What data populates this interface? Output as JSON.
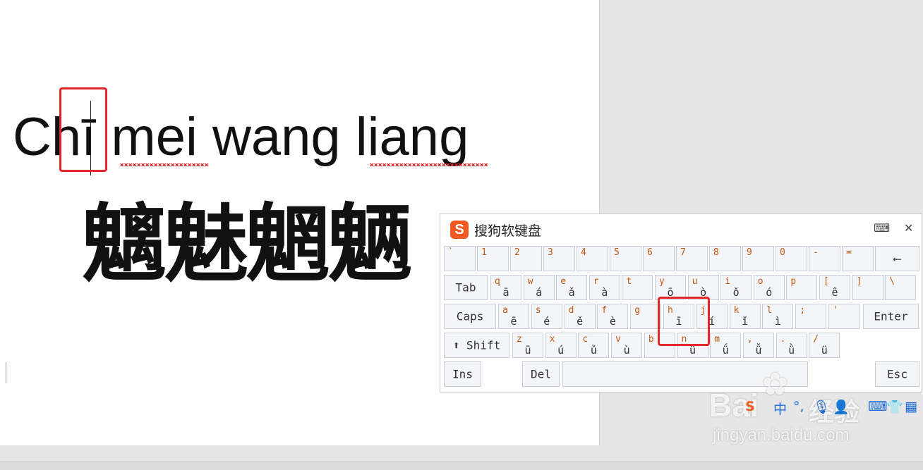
{
  "document": {
    "latin_line": "Chī mei wang liang",
    "cjk_line": "魑魅魍魉"
  },
  "keyboard": {
    "title": "搜狗软键盘",
    "logo": "S",
    "row1": [
      {
        "sym": "`",
        "big": ""
      },
      {
        "sym": "1",
        "big": ""
      },
      {
        "sym": "2",
        "big": ""
      },
      {
        "sym": "3",
        "big": ""
      },
      {
        "sym": "4",
        "big": ""
      },
      {
        "sym": "5",
        "big": ""
      },
      {
        "sym": "6",
        "big": ""
      },
      {
        "sym": "7",
        "big": ""
      },
      {
        "sym": "8",
        "big": ""
      },
      {
        "sym": "9",
        "big": ""
      },
      {
        "sym": "0",
        "big": ""
      },
      {
        "sym": "-",
        "big": ""
      },
      {
        "sym": "=",
        "big": ""
      }
    ],
    "backspace": "⟵",
    "tab": "Tab",
    "row2": [
      {
        "sym": "q",
        "big": "ā"
      },
      {
        "sym": "w",
        "big": "á"
      },
      {
        "sym": "e",
        "big": "ǎ"
      },
      {
        "sym": "r",
        "big": "à"
      },
      {
        "sym": "t",
        "big": ""
      },
      {
        "sym": "y",
        "big": "ō"
      },
      {
        "sym": "u",
        "big": "ò"
      },
      {
        "sym": "i",
        "big": "ǒ"
      },
      {
        "sym": "o",
        "big": "ó"
      },
      {
        "sym": "p",
        "big": ""
      },
      {
        "sym": "[",
        "big": "ê"
      },
      {
        "sym": "]",
        "big": ""
      },
      {
        "sym": "\\",
        "big": ""
      }
    ],
    "caps": "Caps",
    "row3": [
      {
        "sym": "a",
        "big": "ē"
      },
      {
        "sym": "s",
        "big": "é"
      },
      {
        "sym": "d",
        "big": "ě"
      },
      {
        "sym": "f",
        "big": "è"
      },
      {
        "sym": "g",
        "big": ""
      },
      {
        "sym": "h",
        "big": "ī"
      },
      {
        "sym": "j",
        "big": "í"
      },
      {
        "sym": "k",
        "big": "ǐ"
      },
      {
        "sym": "l",
        "big": "ì"
      },
      {
        "sym": ";",
        "big": ""
      },
      {
        "sym": "'",
        "big": ""
      }
    ],
    "enter": "Enter",
    "shift": "⬆ Shift",
    "row4": [
      {
        "sym": "z",
        "big": "ū"
      },
      {
        "sym": "x",
        "big": "ú"
      },
      {
        "sym": "c",
        "big": "ǔ"
      },
      {
        "sym": "v",
        "big": "ù"
      },
      {
        "sym": "b",
        "big": ""
      },
      {
        "sym": "n",
        "big": "ü"
      },
      {
        "sym": "m",
        "big": "ǘ"
      },
      {
        "sym": ",",
        "big": "ǚ"
      },
      {
        "sym": ".",
        "big": "ǜ"
      },
      {
        "sym": "/",
        "big": "ü"
      }
    ],
    "ins": "Ins",
    "del": "Del",
    "esc": "Esc"
  },
  "watermark": {
    "brand": "Bai",
    "brand2": "经验",
    "url": "jingyan.baidu.com"
  },
  "colors": {
    "highlight": "#e8262a",
    "accent": "#ef5a22",
    "key_symbol": "#c25a14"
  }
}
